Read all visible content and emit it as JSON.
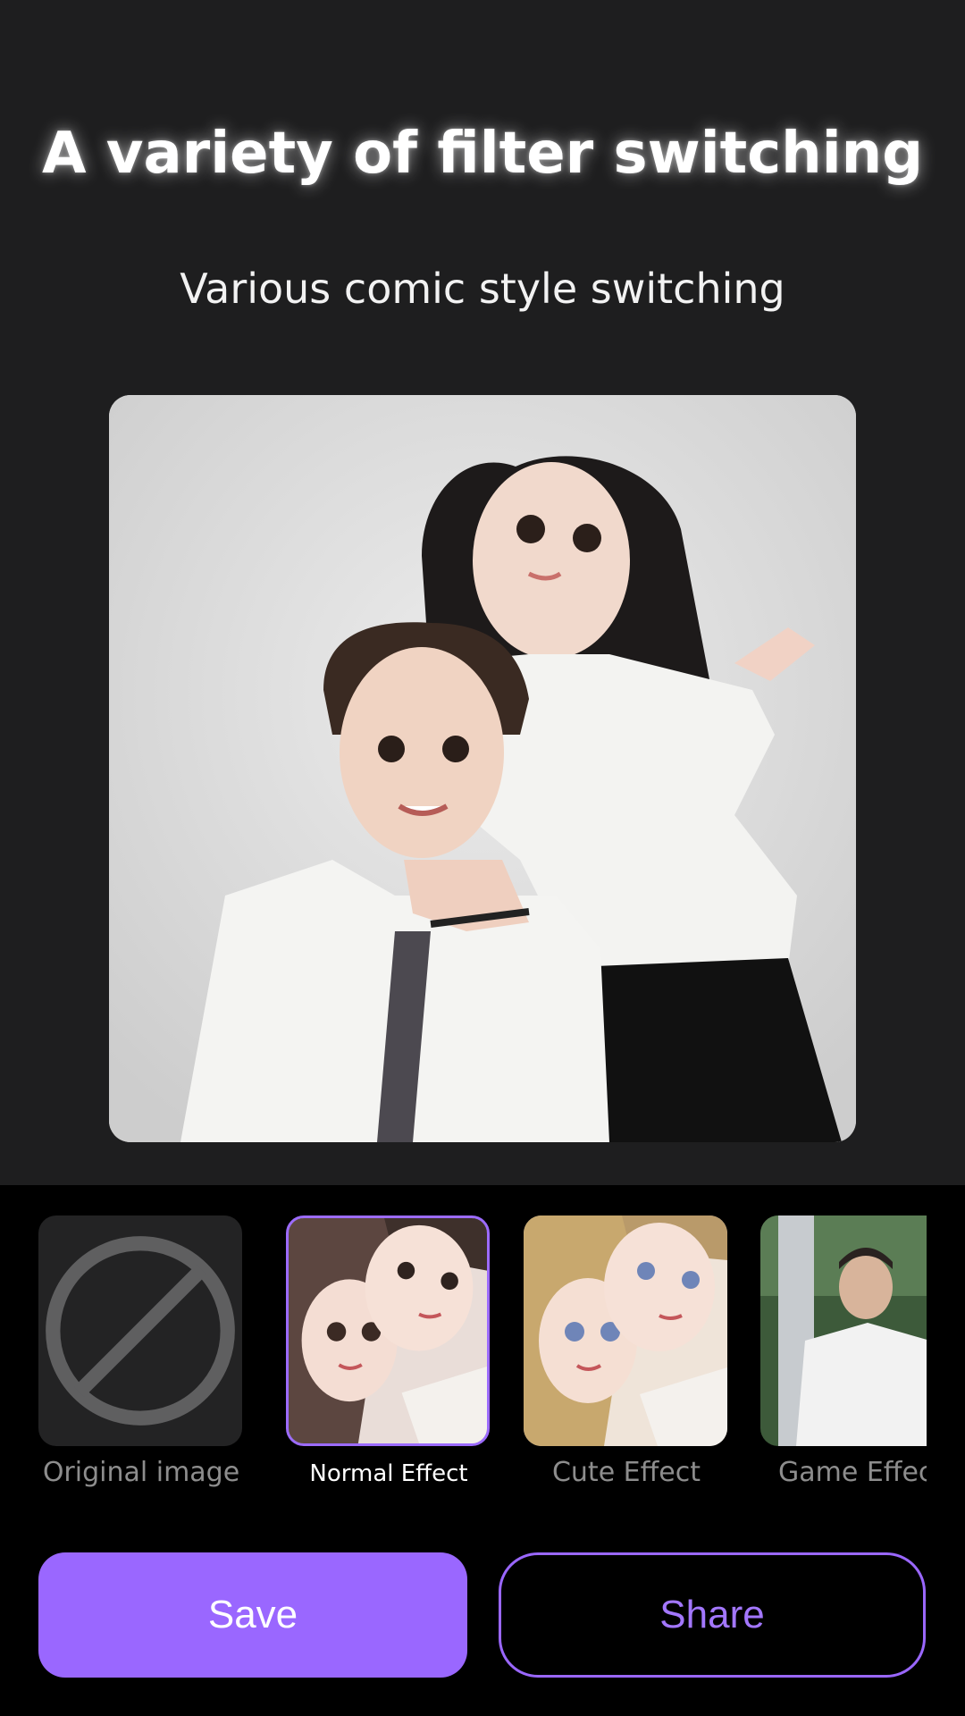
{
  "header": {
    "title": "A variety of filter switching",
    "subtitle": "Various comic style switching"
  },
  "filters": [
    {
      "label": "Original image",
      "icon": "ban-icon",
      "selected": false
    },
    {
      "label": "Normal Effect",
      "selected": true
    },
    {
      "label": "Cute Effect",
      "selected": false
    },
    {
      "label": "Game Effec",
      "selected": false
    }
  ],
  "actions": {
    "save_label": "Save",
    "share_label": "Share"
  },
  "colors": {
    "accent": "#9a67ff",
    "background": "#1e1e1f",
    "panel": "#000000"
  }
}
